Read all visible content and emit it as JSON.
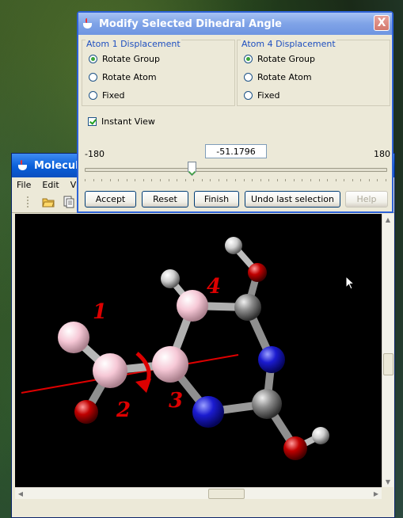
{
  "dialog": {
    "title": "Modify Selected Dihedral Angle",
    "close_label": "X",
    "atom1": {
      "title": "Atom 1 Displacement",
      "options": [
        "Rotate Group",
        "Rotate Atom",
        "Fixed"
      ],
      "selected": "Rotate Group"
    },
    "atom4": {
      "title": "Atom 4 Displacement",
      "options": [
        "Rotate Group",
        "Rotate Atom",
        "Fixed"
      ],
      "selected": "Rotate Group"
    },
    "instant_view": {
      "label": "Instant View",
      "checked": true
    },
    "slider": {
      "min_label": "-180",
      "max_label": "180",
      "value": "-51.1796",
      "min": -180,
      "max": 180,
      "current": -51.1796
    },
    "buttons": {
      "accept": "Accept",
      "reset": "Reset",
      "finish": "Finish",
      "undo": "Undo last selection",
      "help": "Help"
    }
  },
  "main_window": {
    "title": "Molecular",
    "menu": {
      "file": "File",
      "edit": "Edit",
      "view": "Vie"
    }
  },
  "viewport": {
    "background": "#000000",
    "atom_labels": {
      "a1": "1",
      "a2": "2",
      "a3": "3",
      "a4": "4"
    },
    "colors": {
      "label": "#dd0000",
      "axis": "#dd0000",
      "carbon": "#7a7a7a",
      "nitrogen": "#1b1bd0",
      "oxygen": "#c00000",
      "hydrogen": "#e8e8e8",
      "selected": "#f6c8d6"
    }
  }
}
